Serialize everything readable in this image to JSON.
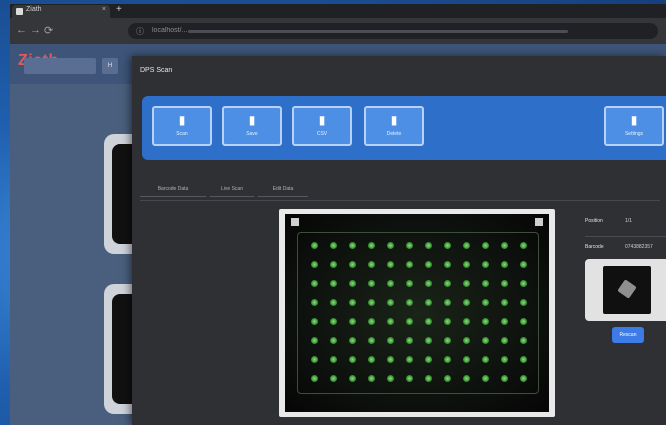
{
  "window": {
    "tab_title": "Ziath",
    "tab_close": "×",
    "new_tab": "+",
    "url": "localhost/..."
  },
  "app": {
    "logo": "Ziath",
    "nav_buttons": [
      "",
      "H"
    ]
  },
  "modal": {
    "title": "DPS Scan",
    "toolbar": [
      {
        "label": "Scan",
        "icon": "file-icon"
      },
      {
        "label": "Save",
        "icon": "file-icon"
      },
      {
        "label": "CSV",
        "icon": "file-icon"
      },
      {
        "label": "Delete",
        "icon": "file-icon"
      },
      {
        "label": "Settings",
        "icon": "file-icon"
      }
    ],
    "tabs": [
      "Barcode Data",
      "Live Scan",
      "Edit Data"
    ],
    "info": [
      {
        "key": "Position",
        "value": "1/1"
      },
      {
        "key": "Barcode",
        "value": "0743882357"
      }
    ],
    "action_button": "Rescan"
  },
  "colors": {
    "toolbar_bg": "#2d6fc9",
    "tool_button": "#4e8fe6",
    "modal_bg": "#2f3033",
    "well_green": "#5fbf52",
    "primary": "#3d7be6"
  }
}
